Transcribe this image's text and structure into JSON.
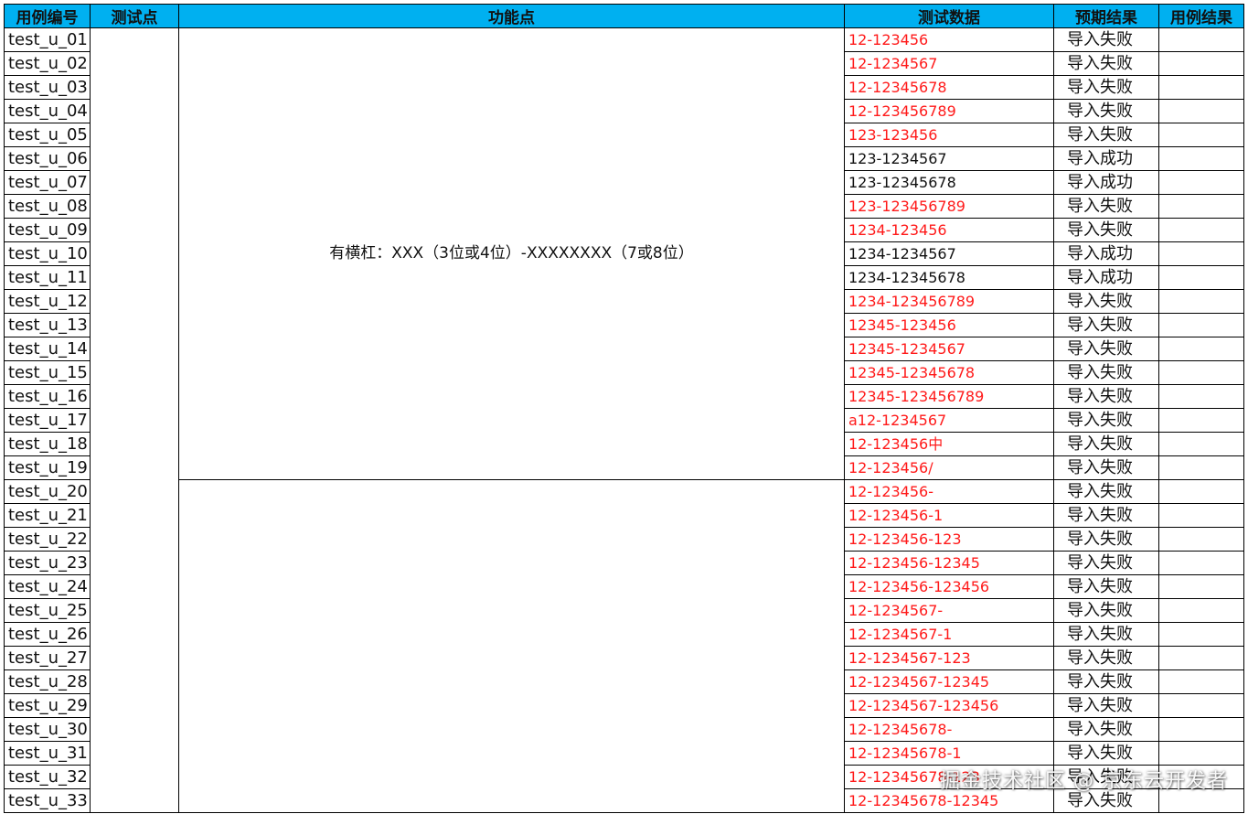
{
  "headers": [
    "用例编号",
    "测试点",
    "功能点",
    "测试数据",
    "预期结果",
    "用例结果"
  ],
  "function_points": [
    "有横杠：XXX（3位或4位）-XXXXXXXX（7或8位）",
    ""
  ],
  "rows": [
    {
      "id": "test_u_01",
      "data": "12-123456",
      "expected": "导入失败",
      "status": "fail"
    },
    {
      "id": "test_u_02",
      "data": "12-1234567",
      "expected": "导入失败",
      "status": "fail"
    },
    {
      "id": "test_u_03",
      "data": "12-12345678",
      "expected": "导入失败",
      "status": "fail"
    },
    {
      "id": "test_u_04",
      "data": "12-123456789",
      "expected": "导入失败",
      "status": "fail"
    },
    {
      "id": "test_u_05",
      "data": "123-123456",
      "expected": "导入失败",
      "status": "fail"
    },
    {
      "id": "test_u_06",
      "data": "123-1234567",
      "expected": "导入成功",
      "status": "pass"
    },
    {
      "id": "test_u_07",
      "data": "123-12345678",
      "expected": "导入成功",
      "status": "pass"
    },
    {
      "id": "test_u_08",
      "data": "123-123456789",
      "expected": "导入失败",
      "status": "fail"
    },
    {
      "id": "test_u_09",
      "data": "1234-123456",
      "expected": "导入失败",
      "status": "fail"
    },
    {
      "id": "test_u_10",
      "data": "1234-1234567",
      "expected": "导入成功",
      "status": "pass"
    },
    {
      "id": "test_u_11",
      "data": "1234-12345678",
      "expected": "导入成功",
      "status": "pass"
    },
    {
      "id": "test_u_12",
      "data": "1234-123456789",
      "expected": "导入失败",
      "status": "fail"
    },
    {
      "id": "test_u_13",
      "data": "12345-123456",
      "expected": "导入失败",
      "status": "fail"
    },
    {
      "id": "test_u_14",
      "data": "12345-1234567",
      "expected": "导入失败",
      "status": "fail"
    },
    {
      "id": "test_u_15",
      "data": "12345-12345678",
      "expected": "导入失败",
      "status": "fail"
    },
    {
      "id": "test_u_16",
      "data": "12345-123456789",
      "expected": "导入失败",
      "status": "fail"
    },
    {
      "id": "test_u_17",
      "data": "a12-1234567",
      "expected": "导入失败",
      "status": "fail"
    },
    {
      "id": "test_u_18",
      "data": "12-123456中",
      "expected": "导入失败",
      "status": "fail"
    },
    {
      "id": "test_u_19",
      "data": "12-123456/",
      "expected": "导入失败",
      "status": "fail"
    },
    {
      "id": "test_u_20",
      "data": "12-123456-",
      "expected": "导入失败",
      "status": "fail"
    },
    {
      "id": "test_u_21",
      "data": "12-123456-1",
      "expected": "导入失败",
      "status": "fail"
    },
    {
      "id": "test_u_22",
      "data": "12-123456-123",
      "expected": "导入失败",
      "status": "fail"
    },
    {
      "id": "test_u_23",
      "data": "12-123456-12345",
      "expected": "导入失败",
      "status": "fail"
    },
    {
      "id": "test_u_24",
      "data": "12-123456-123456",
      "expected": "导入失败",
      "status": "fail"
    },
    {
      "id": "test_u_25",
      "data": "12-1234567-",
      "expected": "导入失败",
      "status": "fail"
    },
    {
      "id": "test_u_26",
      "data": "12-1234567-1",
      "expected": "导入失败",
      "status": "fail"
    },
    {
      "id": "test_u_27",
      "data": "12-1234567-123",
      "expected": "导入失败",
      "status": "fail"
    },
    {
      "id": "test_u_28",
      "data": "12-1234567-12345",
      "expected": "导入失败",
      "status": "fail"
    },
    {
      "id": "test_u_29",
      "data": "12-1234567-123456",
      "expected": "导入失败",
      "status": "fail"
    },
    {
      "id": "test_u_30",
      "data": "12-12345678-",
      "expected": "导入失败",
      "status": "fail"
    },
    {
      "id": "test_u_31",
      "data": "12-12345678-1",
      "expected": "导入失败",
      "status": "fail"
    },
    {
      "id": "test_u_32",
      "data": "12-12345678-123",
      "expected": "导入失败",
      "status": "fail"
    },
    {
      "id": "test_u_33",
      "data": "12-12345678-12345",
      "expected": "导入失败",
      "status": "fail"
    }
  ],
  "watermark": "掘金技术社区 @ 京东云开发者",
  "colors": {
    "header_bg": "#00b0f0",
    "fail_text": "#ff1a1a",
    "pass_text": "#111111",
    "grid": "#000000"
  }
}
